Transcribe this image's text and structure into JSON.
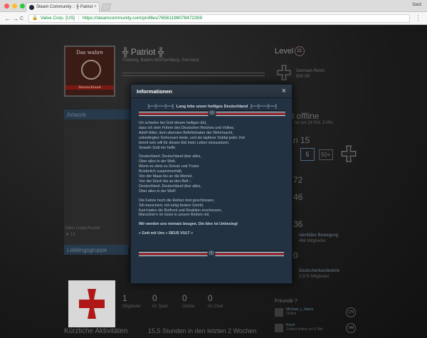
{
  "browser": {
    "tab_title": "Steam Community :: ╬ Patriot",
    "tab_close": "×",
    "user_label": "Gast",
    "back": "←",
    "forward": "→",
    "reload": "C",
    "security_label": "Valve Corp. [US]",
    "url": "https://steamcommunity.com/profiles/76561198078472359",
    "menu": "⋮"
  },
  "background": {
    "avatar_top_text": "Das wahre",
    "avatar_bottom_text": "Deutschland",
    "profile_name": "╬ Patriot ╬",
    "location": "Freiburg, Baden-Württemberg, Germany",
    "level_label": "Level",
    "level_value": "21",
    "badge_name": "Germain Reich",
    "badge_xp": "500 XP",
    "status": "t offline",
    "status_sub": "ne vor 24 Std. 3 Min.",
    "badges_count": "n 15",
    "badge_level": "5",
    "badge_more": "50+",
    "artwork_header": "Artwork",
    "artwork_caption": "Mein Lieger/Kader",
    "artwork_stats": "13",
    "favorite_group_header": "Lieblingsgruppe",
    "stat_members": "1",
    "stat_members_label": "Mitglieder",
    "stat_ingame": "0",
    "stat_ingame_label": "Im Spiel",
    "stat_online": "0",
    "stat_online_label": "Online",
    "stat_chat": "0",
    "stat_chat_label": "Im Chat",
    "recent_activity": "Kürzliche Aktivitäten",
    "hours_played": "15,5 Stunden in den letzten 2 Wochen",
    "side_numbers": [
      "72",
      "46",
      "36",
      "0"
    ],
    "group_name_1": "Identitäre Bewegung",
    "group_members_1": "466 Mitglieder",
    "group_name_2": "Deutscherbundesbrie",
    "group_members_2": "2.976 Mitglieder",
    "friends_label": "Freunde",
    "friends_count": "7",
    "friends": [
      {
        "name": "Michael_v_Adam",
        "status": "Online",
        "count": "175"
      },
      {
        "name": "Kevin",
        "status": "Zuletzt online vor 5 Std.",
        "count": "148"
      }
    ]
  },
  "modal": {
    "title": "Informationen",
    "close": "×",
    "banner_deco_left": "╠══╬═══╬══╣",
    "banner_text": "Lang lebe unser heiliges Deutschland",
    "banner_deco_right": "╠══╬═══╬══╣",
    "stripe_mid": "[╬]",
    "paragraphs": [
      {
        "bold": false,
        "lines": [
          "Ich schwöre bei Gott diesen heiligen Eid,",
          "dass ich dem Führer des Deutschen Reiches und Volkes,",
          "Adolf Hitler, dem obersten Befehlshaber der Wehrmacht,",
          "unbedingten Gehorsam leiste, und als tapferer Soldat jeder Zeit",
          "bereit sein will für diesen Eid mein Leben einzusetzen.",
          "Sowahr Gott mir helfe."
        ]
      },
      {
        "bold": false,
        "lines": [
          "Deutschland, Deutschland über alles,",
          "Über alles in der Welt,",
          "Wenn es stets zu Schutz und Trutze",
          "Brüderlich zusammenhält,",
          "Von der Maas bis an die Memel,",
          "Von der Etsch bis an den Belt –",
          "Deutschland, Deutschland über alles,",
          "Über alles in der Welt!"
        ]
      },
      {
        "bold": false,
        "lines": [
          "Die Fahne hoch die Reihen fest geschlossen,",
          "SA marschiert, mit ruhig festem Schritt.",
          "Kam'raden die Rotfront und Reaktion erschossen,",
          "Marschier'n im Geist in unsern Reihen mit."
        ]
      },
      {
        "bold": true,
        "lines": [
          "Wir werden uns niemals beugen. Die Idee ist Unbesiegt"
        ]
      },
      {
        "bold": true,
        "lines": [
          "« Gott mit Uns » DEUS VULT »"
        ]
      }
    ]
  },
  "colors": {
    "stripe_red": "#c8282e",
    "stripe_white": "#e8e8e8",
    "stripe_dark": "#15191f",
    "modal_bg": "#223242"
  }
}
